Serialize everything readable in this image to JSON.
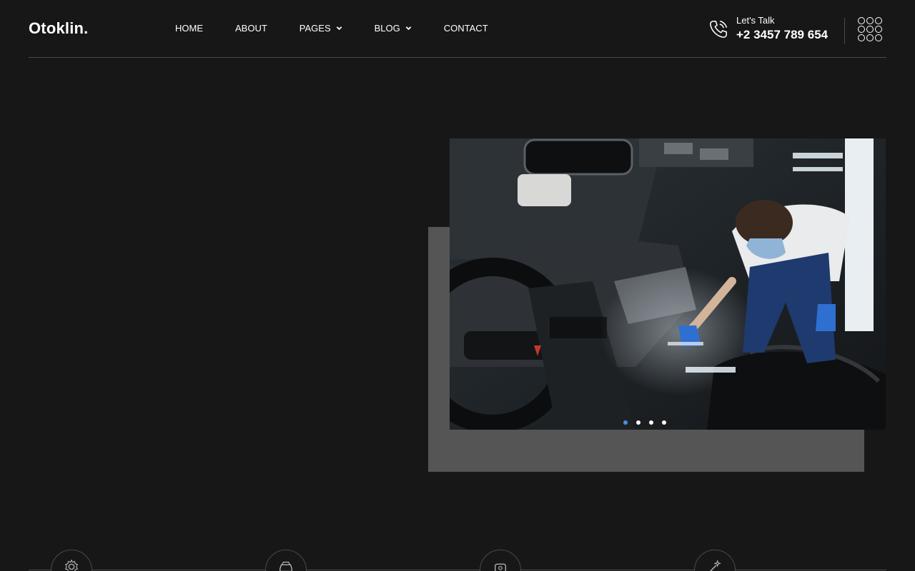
{
  "brand": {
    "logo": "Otoklin."
  },
  "nav": {
    "items": [
      {
        "label": "HOME",
        "has_dropdown": false
      },
      {
        "label": "ABOUT",
        "has_dropdown": false
      },
      {
        "label": "PAGES",
        "has_dropdown": true
      },
      {
        "label": "BLOG",
        "has_dropdown": true
      },
      {
        "label": "CONTACT",
        "has_dropdown": false
      }
    ]
  },
  "contact": {
    "label": "Let's Talk",
    "phone": "+2 3457 789 654",
    "icon": "phone-icon"
  },
  "menu_button": {
    "icon": "grid-dots-icon"
  },
  "hero": {
    "image_description_icon": "car-interior-cleaning-photo",
    "slider": {
      "slides": 4,
      "active_index": 0
    }
  },
  "features": {
    "icons": [
      "gear-icon",
      "car-icon",
      "steering-icon",
      "sparkle-icon"
    ]
  },
  "colors": {
    "background": "#171717",
    "accent_dot": "#4a90d9",
    "backdrop": "#555555",
    "divider": "#4a4a4a"
  }
}
